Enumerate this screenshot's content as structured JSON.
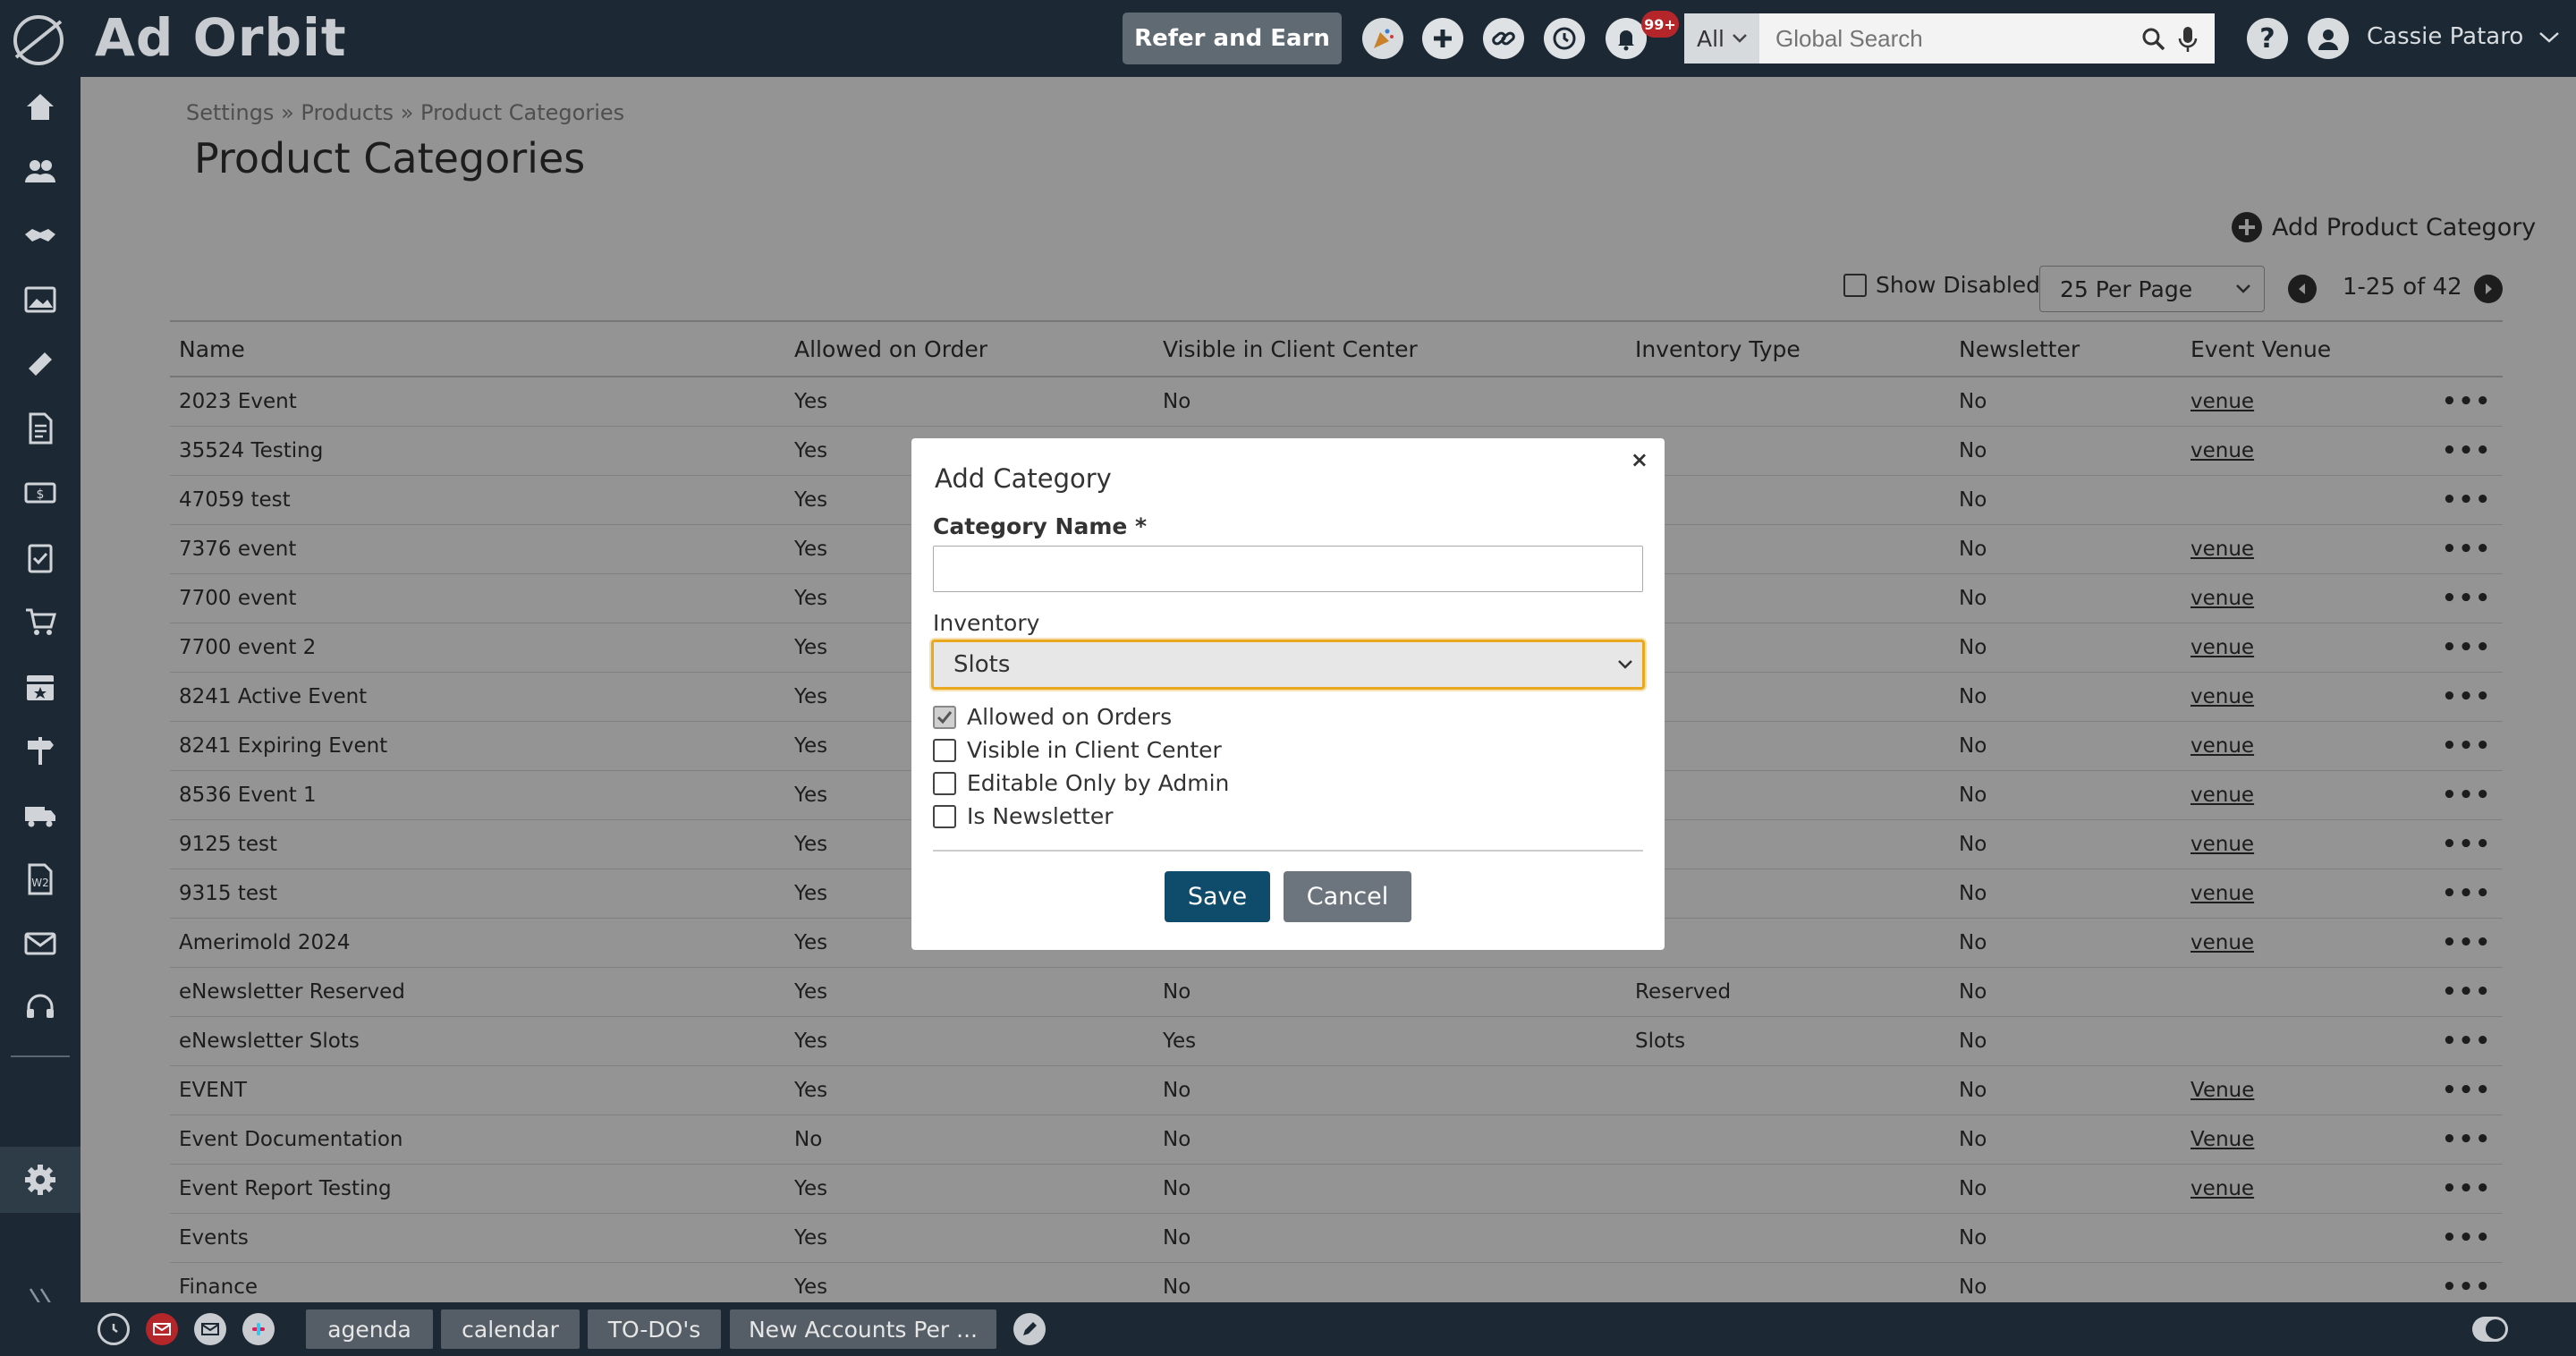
{
  "app": {
    "title": "Ad Orbit"
  },
  "topbar": {
    "refer_label": "Refer and Earn",
    "notification_count": "99+",
    "search_category": "All",
    "search_placeholder": "Global Search",
    "user_name": "Cassie Pataro"
  },
  "breadcrumb": {
    "items": [
      "Settings",
      "Products",
      "Product Categories"
    ],
    "separator": "»"
  },
  "page": {
    "title": "Product Categories",
    "add_label": "Add Product Category",
    "show_disabled_label": "Show Disabled",
    "per_page": "25 Per Page",
    "range": "1-25 of 42"
  },
  "table": {
    "headers": [
      "Name",
      "Allowed on Order",
      "Visible in Client Center",
      "Inventory Type",
      "Newsletter",
      "Event Venue"
    ],
    "rows": [
      [
        "2023 Event",
        "Yes",
        "No",
        "",
        "No",
        "venue"
      ],
      [
        "35524 Testing",
        "Yes",
        "",
        "",
        "No",
        "venue"
      ],
      [
        "47059 test",
        "Yes",
        "",
        "",
        "No",
        ""
      ],
      [
        "7376 event",
        "Yes",
        "",
        "",
        "No",
        "venue"
      ],
      [
        "7700 event",
        "Yes",
        "",
        "",
        "No",
        "venue"
      ],
      [
        "7700 event 2",
        "Yes",
        "",
        "",
        "No",
        "venue"
      ],
      [
        "8241 Active Event",
        "Yes",
        "",
        "",
        "No",
        "venue"
      ],
      [
        "8241 Expiring Event",
        "Yes",
        "",
        "",
        "No",
        "venue"
      ],
      [
        "8536 Event 1",
        "Yes",
        "",
        "",
        "No",
        "venue"
      ],
      [
        "9125 test",
        "Yes",
        "",
        "",
        "No",
        "venue"
      ],
      [
        "9315 test",
        "Yes",
        "",
        "",
        "No",
        "venue"
      ],
      [
        "Amerimold 2024",
        "Yes",
        "",
        "",
        "No",
        "venue"
      ],
      [
        "eNewsletter Reserved",
        "Yes",
        "No",
        "Reserved",
        "No",
        ""
      ],
      [
        "eNewsletter Slots",
        "Yes",
        "Yes",
        "Slots",
        "No",
        ""
      ],
      [
        "EVENT",
        "Yes",
        "No",
        "",
        "No",
        "Venue"
      ],
      [
        "Event Documentation",
        "No",
        "No",
        "",
        "No",
        "Venue"
      ],
      [
        "Event Report Testing",
        "Yes",
        "No",
        "",
        "No",
        "venue"
      ],
      [
        "Events",
        "Yes",
        "No",
        "",
        "No",
        ""
      ],
      [
        "Finance",
        "Yes",
        "No",
        "",
        "No",
        ""
      ]
    ]
  },
  "modal": {
    "title": "Add Category",
    "close": "×",
    "name_label": "Category Name *",
    "name_value": "",
    "inventory_label": "Inventory",
    "inventory_value": "Slots",
    "checks": [
      {
        "label": "Allowed on Orders",
        "checked": true
      },
      {
        "label": "Visible in Client Center",
        "checked": false
      },
      {
        "label": "Editable Only by Admin",
        "checked": false
      },
      {
        "label": "Is Newsletter",
        "checked": false
      }
    ],
    "save": "Save",
    "cancel": "Cancel"
  },
  "bottombar": {
    "tabs": [
      "agenda",
      "calendar",
      "TO-DO's",
      "New Accounts Per ..."
    ]
  },
  "colors": {
    "nav_bg": "#1c2833",
    "primary": "#0f4b6b",
    "focus": "#e8a820",
    "badge": "#b4262a"
  }
}
